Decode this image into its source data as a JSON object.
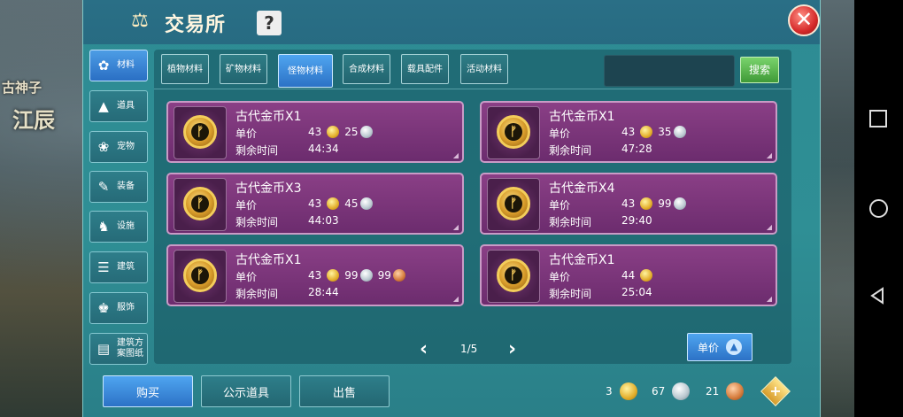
{
  "background": {
    "text1": "古神子",
    "text2": "江辰"
  },
  "window": {
    "title": "交易所",
    "help_label": "?",
    "close_label": "✕"
  },
  "sidebar": {
    "items": [
      {
        "label": "材料",
        "icon": "materials-icon",
        "glyph": "✿",
        "active": true
      },
      {
        "label": "道具",
        "icon": "item-icon",
        "glyph": "▲",
        "active": false
      },
      {
        "label": "宠物",
        "icon": "paw-icon",
        "glyph": "❀",
        "active": false
      },
      {
        "label": "装备",
        "icon": "equipment-icon",
        "glyph": "✎",
        "active": false
      },
      {
        "label": "设施",
        "icon": "facility-icon",
        "glyph": "♞",
        "active": false
      },
      {
        "label": "建筑",
        "icon": "building-icon",
        "glyph": "☰",
        "active": false
      },
      {
        "label": "服饰",
        "icon": "clothing-icon",
        "glyph": "♚",
        "active": false
      },
      {
        "label": "建筑方案图纸",
        "icon": "blueprint-icon",
        "glyph": "▤",
        "active": false
      }
    ]
  },
  "tabs": [
    {
      "label": "植物材料",
      "active": false
    },
    {
      "label": "矿物材料",
      "active": false
    },
    {
      "label": "怪物材料",
      "active": true
    },
    {
      "label": "合成材料",
      "active": false
    },
    {
      "label": "载具配件",
      "active": false
    },
    {
      "label": "活动材料",
      "active": false
    }
  ],
  "search": {
    "placeholder": "",
    "button_label": "搜索"
  },
  "labels": {
    "price": "单价",
    "remaining": "剩余时间"
  },
  "listings": [
    {
      "name": "古代金币X1",
      "gold": "43",
      "silver": "25",
      "bronze": "",
      "time": "44:34"
    },
    {
      "name": "古代金币X1",
      "gold": "43",
      "silver": "35",
      "bronze": "",
      "time": "47:28"
    },
    {
      "name": "古代金币X3",
      "gold": "43",
      "silver": "45",
      "bronze": "",
      "time": "44:03"
    },
    {
      "name": "古代金币X4",
      "gold": "43",
      "silver": "99",
      "bronze": "",
      "time": "29:40"
    },
    {
      "name": "古代金币X1",
      "gold": "43",
      "silver": "99",
      "bronze": "99",
      "time": "28:44"
    },
    {
      "name": "古代金币X1",
      "gold": "44",
      "silver": "",
      "bronze": "",
      "time": "25:04"
    }
  ],
  "pager": {
    "text": "1/5",
    "prev": "‹",
    "next": "›"
  },
  "sort": {
    "label": "单价"
  },
  "bottom": {
    "buy": "购买",
    "public": "公示道具",
    "sell": "出售"
  },
  "wallet": {
    "gold": "3",
    "silver": "67",
    "bronze": "21",
    "add": "+"
  },
  "colors": {
    "accent": "#2c72c6",
    "card": "#7a3479",
    "search": "#3f9a37"
  }
}
